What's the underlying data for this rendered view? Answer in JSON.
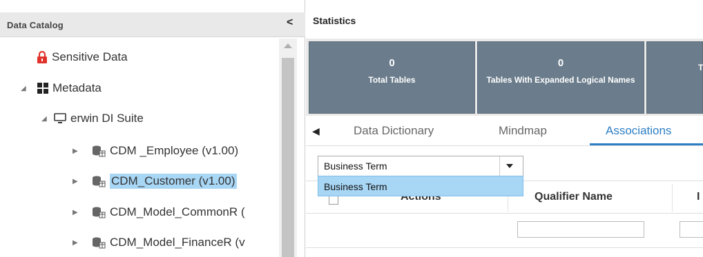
{
  "left_panel": {
    "title": "Data Catalog",
    "collapse_glyph": "<",
    "tree": [
      {
        "label": "Sensitive Data",
        "icon": "lock-icon",
        "expander": ""
      },
      {
        "label": "Metadata",
        "icon": "grid-icon",
        "expander": "◢"
      },
      {
        "label": "erwin DI Suite",
        "icon": "monitor-icon",
        "expander": "◢"
      },
      {
        "label": "CDM _Employee (v1.00)",
        "icon": "model-icon",
        "expander": "▶"
      },
      {
        "label": "CDM_Customer (v1.00)",
        "icon": "model-icon",
        "expander": "▶",
        "selected": true
      },
      {
        "label": "CDM_Model_CommonR (",
        "icon": "model-icon",
        "expander": "▶"
      },
      {
        "label": "CDM_Model_FinanceR (v",
        "icon": "model-icon",
        "expander": "▶"
      }
    ]
  },
  "statistics": {
    "title": "Statistics",
    "cards": [
      {
        "value": "0",
        "label": "Total Tables"
      },
      {
        "value": "0",
        "label": "Tables With Expanded Logical Names"
      },
      {
        "value": "",
        "label": "T"
      }
    ]
  },
  "tabs": {
    "prev_glyph": "◀",
    "items": [
      "Data Dictionary",
      "Mindmap",
      "Associations"
    ],
    "active": "Associations"
  },
  "filter": {
    "value": "Business Term",
    "option": "Business Term"
  },
  "grid": {
    "columns": [
      "Actions",
      "Qualifier Name",
      "I"
    ]
  },
  "colors": {
    "card_bg": "#6b7d8c",
    "active_tab": "#2d7ec4",
    "selection": "#a8d6f5",
    "lock_red": "#e0322b"
  }
}
